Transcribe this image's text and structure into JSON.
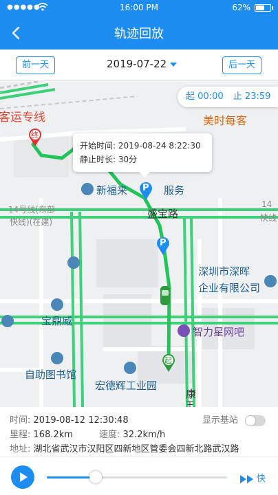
{
  "status": {
    "time": "16:00 PM",
    "battery": "62%",
    "battery_level": 0.62
  },
  "header": {
    "title": "轨迹回放"
  },
  "datebar": {
    "prev_label": "前一天",
    "date": "2019-07-22",
    "next_label": "后一天"
  },
  "time_range": {
    "start_label": "起",
    "start_time": "00:00",
    "end_label": "止",
    "end_time": "23:59"
  },
  "popup": {
    "start_label": "开始时间:",
    "start_value": "2019-08-24  8:22:30",
    "stop_label": "静止时长:",
    "stop_value": "30分"
  },
  "map": {
    "labels": {
      "passenger_line": "客运专线",
      "meishi": "美时每客",
      "xinfulai": "新福来",
      "service": "服务",
      "line14_left_1": "14号线(东部",
      "line14_left_2": "快线)(在建)",
      "line14_right_1": "14",
      "line14_right_2": "快线",
      "shengbao": "盛宝路",
      "company_1": "深圳市深晖",
      "company_2": "企业有限公司",
      "baoding": "宝鼎威",
      "zhili": "智力星网吧",
      "library": "自助图书馆",
      "hongde": "宏德辉工业园",
      "kang": "康",
      "kang2": "王"
    },
    "markers": {
      "end": "终",
      "start": "起",
      "parking": "P"
    }
  },
  "info": {
    "time_label": "时间:",
    "time_value": "2019-08-12  12:30:48",
    "mileage_label": "里程:",
    "mileage_value": "168.2km",
    "speed_label": "速度:",
    "speed_value": "32.2km/h",
    "address_label": "地址:",
    "address_value": "湖北省武汉市汉阳区四新地区管委会四新北路武汉路",
    "toggle_label": "显示基站",
    "toggle_on": false
  },
  "player": {
    "progress": 0.27,
    "speed_label": "快"
  },
  "colors": {
    "accent": "#1e8df2",
    "route": "#22c45a",
    "road": "#3fd07a"
  }
}
